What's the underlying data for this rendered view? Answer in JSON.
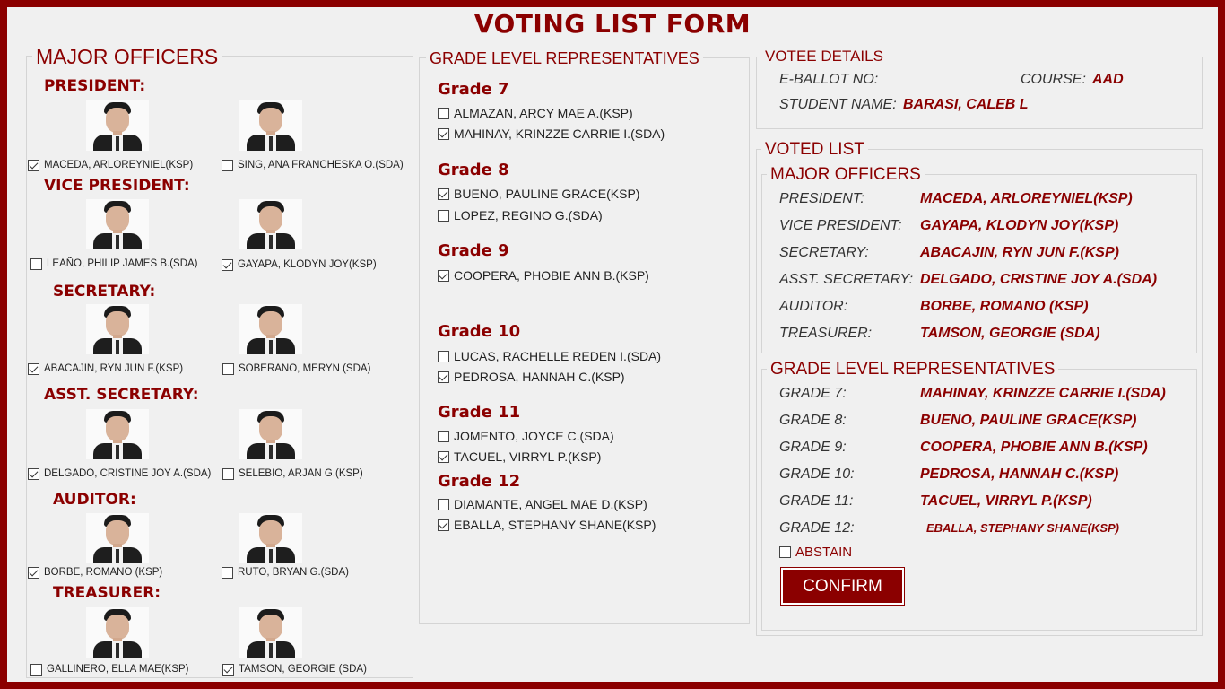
{
  "title": "VOTING LIST FORM",
  "major": {
    "legend": "MAJOR OFFICERS",
    "positions": [
      {
        "title": "PRESIDENT:",
        "candidates": [
          {
            "name": "MACEDA, ARLOREYNIEL(KSP)",
            "checked": true
          },
          {
            "name": "SING, ANA FRANCHESKA O.(SDA)",
            "checked": false
          }
        ]
      },
      {
        "title": "VICE PRESIDENT:",
        "candidates": [
          {
            "name": "LEAÑO, PHILIP JAMES B.(SDA)",
            "checked": false
          },
          {
            "name": "GAYAPA, KLODYN JOY(KSP)",
            "checked": true
          }
        ]
      },
      {
        "title": "SECRETARY:",
        "candidates": [
          {
            "name": "ABACAJIN, RYN JUN F.(KSP)",
            "checked": true
          },
          {
            "name": "SOBERANO, MERYN (SDA)",
            "checked": false
          }
        ]
      },
      {
        "title": "ASST. SECRETARY:",
        "candidates": [
          {
            "name": "DELGADO, CRISTINE JOY A.(SDA)",
            "checked": true
          },
          {
            "name": "SELEBIO, ARJAN G.(KSP)",
            "checked": false
          }
        ]
      },
      {
        "title": "AUDITOR:",
        "candidates": [
          {
            "name": "BORBE, ROMANO (KSP)",
            "checked": true
          },
          {
            "name": "RUTO, BRYAN G.(SDA)",
            "checked": false
          }
        ]
      },
      {
        "title": "TREASURER:",
        "candidates": [
          {
            "name": "GALLINERO, ELLA MAE(KSP)",
            "checked": false
          },
          {
            "name": "TAMSON, GEORGIE (SDA)",
            "checked": true
          }
        ]
      }
    ]
  },
  "grades": {
    "legend": "GRADE LEVEL REPRESENTATIVES",
    "levels": [
      {
        "title": "Grade 7",
        "candidates": [
          {
            "name": "ALMAZAN, ARCY MAE A.(KSP)",
            "checked": false
          },
          {
            "name": "MAHINAY, KRINZZE CARRIE I.(SDA)",
            "checked": true
          }
        ]
      },
      {
        "title": "Grade 8",
        "candidates": [
          {
            "name": "BUENO, PAULINE GRACE(KSP)",
            "checked": true
          },
          {
            "name": "LOPEZ, REGINO G.(SDA)",
            "checked": false
          }
        ]
      },
      {
        "title": "Grade 9",
        "candidates": [
          {
            "name": "COOPERA, PHOBIE ANN B.(KSP)",
            "checked": true
          }
        ]
      },
      {
        "title": "Grade 10",
        "candidates": [
          {
            "name": "LUCAS, RACHELLE REDEN I.(SDA)",
            "checked": false
          },
          {
            "name": "PEDROSA, HANNAH C.(KSP)",
            "checked": true
          }
        ]
      },
      {
        "title": "Grade 11",
        "candidates": [
          {
            "name": "JOMENTO, JOYCE C.(SDA)",
            "checked": false
          },
          {
            "name": "TACUEL, VIRRYL P.(KSP)",
            "checked": true
          }
        ]
      },
      {
        "title": "Grade 12",
        "candidates": [
          {
            "name": "DIAMANTE, ANGEL MAE D.(KSP)",
            "checked": false
          },
          {
            "name": "EBALLA, STEPHANY SHANE(KSP)",
            "checked": true
          }
        ]
      }
    ]
  },
  "votee": {
    "legend": "VOTEE DETAILS",
    "eballot_label": "E-BALLOT NO:",
    "eballot_value": "",
    "course_label": "COURSE:",
    "course_value": "AAD",
    "name_label": "STUDENT NAME:",
    "name_value": "BARASI, CALEB L"
  },
  "voted": {
    "legend": "VOTED LIST",
    "major_legend": "MAJOR OFFICERS",
    "major": [
      {
        "label": "PRESIDENT:",
        "value": "MACEDA, ARLOREYNIEL(KSP)"
      },
      {
        "label": "VICE PRESIDENT:",
        "value": "GAYAPA, KLODYN JOY(KSP)"
      },
      {
        "label": "SECRETARY:",
        "value": "ABACAJIN, RYN JUN F.(KSP)"
      },
      {
        "label": "ASST. SECRETARY:",
        "value": "DELGADO, CRISTINE JOY A.(SDA)"
      },
      {
        "label": "AUDITOR:",
        "value": "BORBE, ROMANO (KSP)"
      },
      {
        "label": "TREASURER:",
        "value": "TAMSON, GEORGIE (SDA)"
      }
    ],
    "grade_legend": "GRADE LEVEL REPRESENTATIVES",
    "grades": [
      {
        "label": "GRADE 7:",
        "value": "MAHINAY, KRINZZE CARRIE I.(SDA)"
      },
      {
        "label": "GRADE 8:",
        "value": "BUENO, PAULINE GRACE(KSP)"
      },
      {
        "label": "GRADE 9:",
        "value": "COOPERA, PHOBIE ANN B.(KSP)"
      },
      {
        "label": "GRADE 10:",
        "value": "PEDROSA, HANNAH C.(KSP)"
      },
      {
        "label": "GRADE 11:",
        "value": "TACUEL, VIRRYL P.(KSP)"
      },
      {
        "label": "GRADE 12:",
        "value": "EBALLA, STEPHANY SHANE(KSP)"
      }
    ],
    "abstain_label": "ABSTAIN",
    "abstain_checked": false,
    "confirm_label": "CONFIRM"
  },
  "colors": {
    "accent": "#8b0000",
    "background": "#f0f0f0"
  },
  "icons": {
    "photo": "candidate-photo-icon",
    "checkbox": "checkbox-icon"
  }
}
